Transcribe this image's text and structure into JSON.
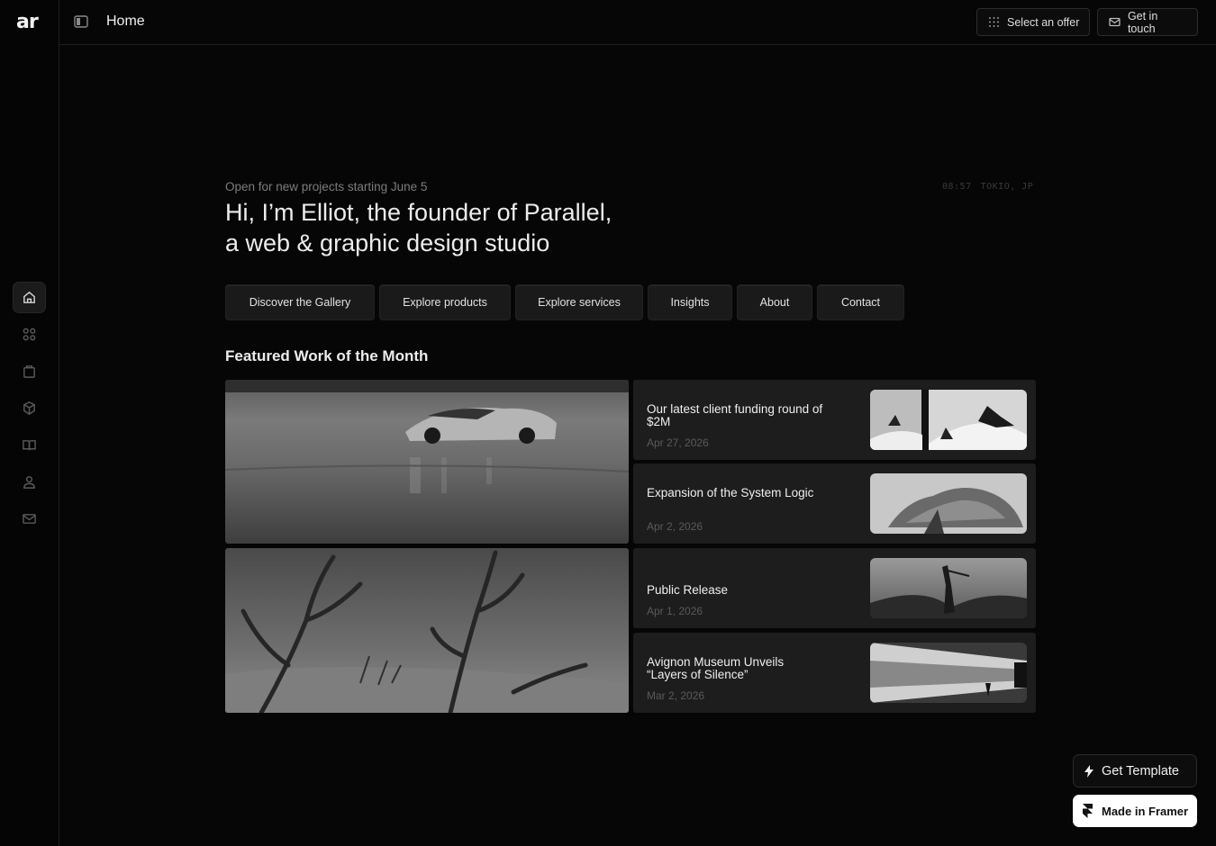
{
  "app": {
    "logo": "ar",
    "page_title": "Home"
  },
  "sidebar": {
    "items": [
      {
        "icon": "home-icon",
        "active": true
      },
      {
        "icon": "gallery-icon",
        "active": false
      },
      {
        "icon": "bag-icon",
        "active": false
      },
      {
        "icon": "box-icon",
        "active": false
      },
      {
        "icon": "book-icon",
        "active": false
      },
      {
        "icon": "user-icon",
        "active": false
      },
      {
        "icon": "mail-icon",
        "active": false
      }
    ]
  },
  "header": {
    "offer_label": "Select an offer",
    "touch_label": "Get in touch"
  },
  "hero": {
    "availability": "Open for new projects starting June 5",
    "time": "08:57",
    "location": "TOKIO, JP",
    "headline_line1": "Hi, I’m Elliot, the founder of Parallel,",
    "headline_line2": "a web & graphic design studio"
  },
  "nav_pills": [
    "Discover the Gallery",
    "Explore products",
    "Explore services",
    "Insights",
    "About",
    "Contact"
  ],
  "featured": {
    "title": "Featured Work of the Month",
    "cards": [
      {
        "title": "Our latest client funding round of $2M",
        "date": "Apr 27, 2026"
      },
      {
        "title": "Expansion of the System Logic",
        "date": "Apr 2, 2026"
      },
      {
        "title": "Public Release",
        "date": "Apr 1, 2026"
      },
      {
        "title": "Avignon Museum Unveils “Layers of Silence”",
        "date": "Mar 2, 2026"
      }
    ]
  },
  "badges": {
    "template": "Get Template",
    "framer": "Made in Framer"
  },
  "colors": {
    "background": "#060606",
    "card": "#1d1d1d",
    "pill": "#1a1a1a",
    "muted_text": "#7c7c7c"
  }
}
